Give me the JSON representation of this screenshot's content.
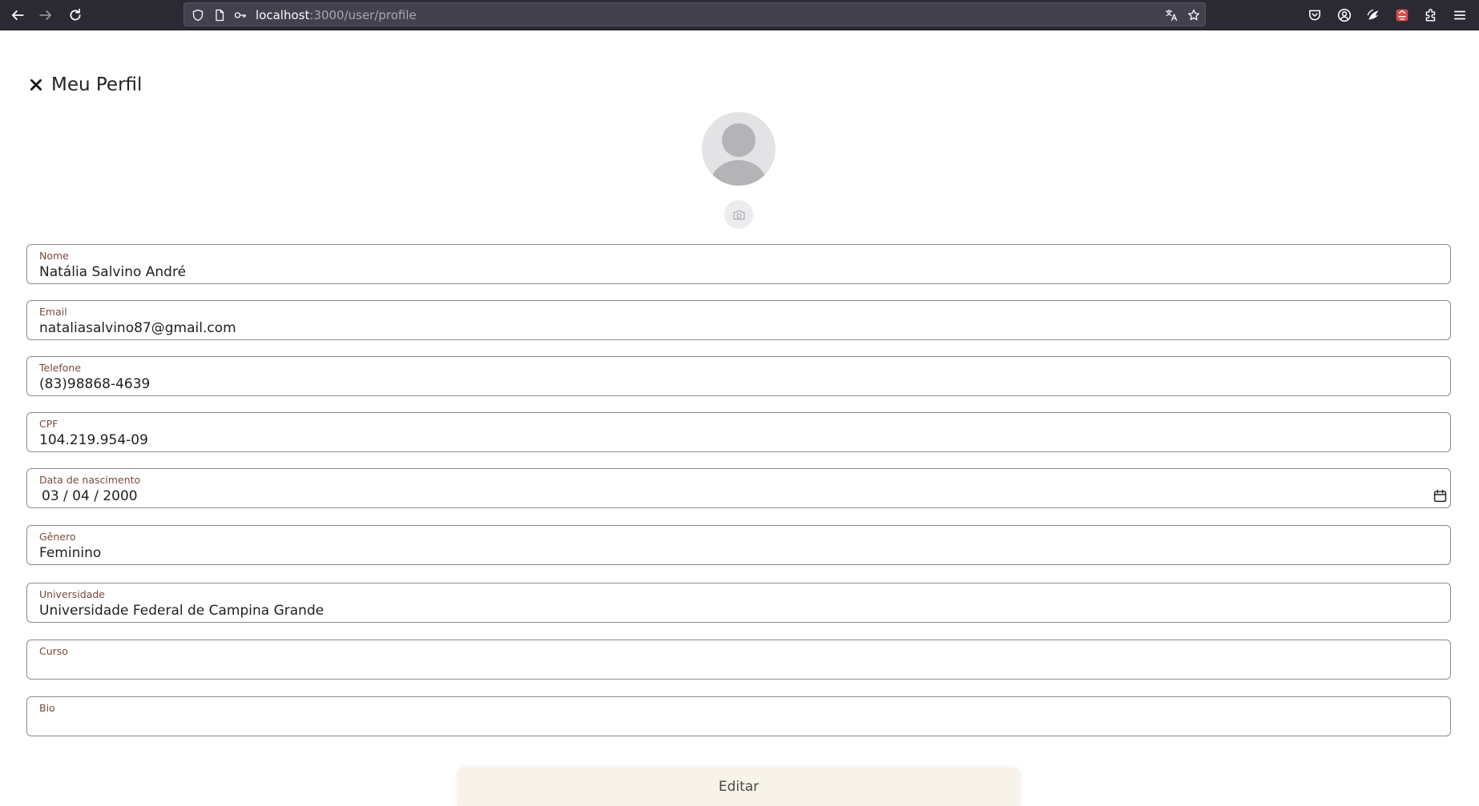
{
  "browser": {
    "url_host": "localhost",
    "url_path": ":3000/user/profile"
  },
  "page": {
    "title": "Meu Perfil"
  },
  "fields": {
    "nome": {
      "label": "Nome",
      "value": "Natália Salvino André"
    },
    "email": {
      "label": "Email",
      "value": "nataliasalvino87@gmail.com"
    },
    "telefone": {
      "label": "Telefone",
      "value": "(83)98868-4639"
    },
    "cpf": {
      "label": "CPF",
      "value": "104.219.954-09"
    },
    "nascimento": {
      "label": "Data de nascimento",
      "value": "03 / 04 / 2000"
    },
    "genero": {
      "label": "Gênero",
      "value": "Feminino"
    },
    "universidade": {
      "label": "Universidade",
      "value": "Universidade Federal de Campina Grande"
    },
    "curso": {
      "label": "Curso",
      "value": ""
    },
    "bio": {
      "label": "Bio",
      "value": ""
    }
  },
  "actions": {
    "edit_label": "Editar"
  },
  "colors": {
    "browser_bg": "#2b2a33",
    "url_bar_bg": "#42414d",
    "label_color": "#7a4a3a",
    "edit_button_bg": "#f7f3e9",
    "avatar_bg": "#e3e3e5"
  },
  "icons": {
    "back": "back-arrow-icon",
    "forward": "forward-arrow-icon",
    "reload": "reload-icon",
    "shield": "tracking-shield-icon",
    "page": "page-info-icon",
    "key": "key-icon",
    "translate": "translate-icon",
    "bookmark": "star-icon",
    "pocket": "pocket-icon",
    "account": "account-icon",
    "extension_paw": "paw-extension-icon",
    "extension_red": "red-extension-icon",
    "extensions": "puzzle-icon",
    "menu": "hamburger-menu-icon",
    "close": "close-icon",
    "camera": "camera-icon",
    "calendar": "calendar-icon"
  }
}
